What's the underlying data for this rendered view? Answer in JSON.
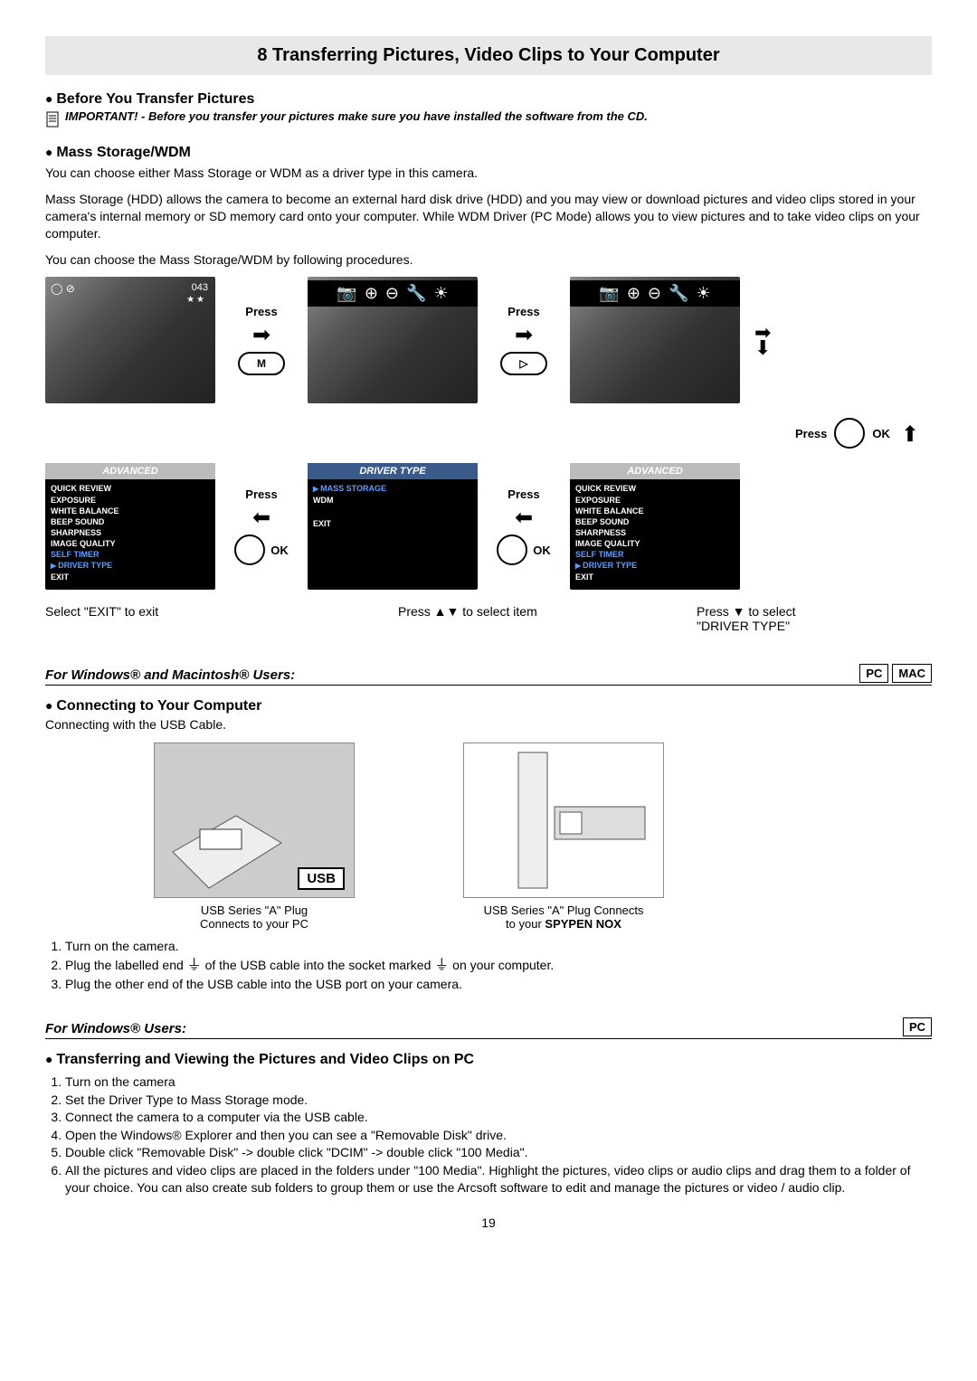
{
  "page": {
    "title": "8 Transferring Pictures, Video Clips to Your Computer",
    "number": "19"
  },
  "s1": {
    "heading": "Before You Transfer Pictures",
    "important": "IMPORTANT! - Before you transfer your pictures make sure you have installed the software from the CD."
  },
  "s2": {
    "heading": "Mass Storage/WDM",
    "p1": "You can choose either Mass Storage or WDM as a driver type in this camera.",
    "p2": "Mass Storage (HDD) allows the camera to become an external hard disk drive (HDD) and you may view or download pictures and video clips stored in your camera's internal memory or SD memory card onto your computer.  While WDM Driver (PC Mode) allows you to view pictures and to take video clips on your computer.",
    "p3": "You can choose the Mass Storage/WDM by following procedures."
  },
  "flow": {
    "press": "Press",
    "ok": "OK",
    "btn_m": "M",
    "btn_play": "▷",
    "screen1_counter": "043",
    "screen1_stars": "★★",
    "icons_camera": "📷",
    "icons_zoomin": "⊕",
    "icons_zoomout": "⊖",
    "icons_tool": "🔧",
    "icons_bright": "☀",
    "menu_adv_title": "ADVANCED",
    "menu_driver_title": "DRIVER TYPE",
    "menu_adv_items": [
      "QUICK REVIEW",
      "EXPOSURE",
      "WHITE BALANCE",
      "BEEP SOUND",
      "SHARPNESS",
      "IMAGE QUALITY",
      "SELF TIMER",
      "DRIVER TYPE",
      "EXIT"
    ],
    "menu_driver_items": [
      "MASS STORAGE",
      "WDM",
      "EXIT"
    ],
    "cap_exit": "Select \"EXIT\" to exit",
    "cap_select_item": "Press ▲▼ to select item",
    "cap_select_driver_a": "Press ▼ to select",
    "cap_select_driver_b": "\"DRIVER TYPE\""
  },
  "users_winmac": {
    "heading": "For Windows® and Macintosh® Users:",
    "badge_pc": "PC",
    "badge_mac": "MAC"
  },
  "s3": {
    "heading": "Connecting to Your Computer",
    "sub": "Connecting with the USB Cable.",
    "illus1_badge": "USB",
    "illus1_cap_a": "USB Series \"A\" Plug",
    "illus1_cap_b": "Connects to your PC",
    "illus2_cap_a": "USB Series \"A\" Plug Connects",
    "illus2_cap_b": "to your ",
    "illus2_cap_bold": "SPYPEN NOX",
    "step1": "Turn on the camera.",
    "step2a": "Plug the labelled end ",
    "step2b": " of the USB cable into the socket marked ",
    "step2c": " on your computer.",
    "step3": "Plug the other end of the USB cable into the USB port on your camera."
  },
  "users_win": {
    "heading": "For Windows® Users:",
    "badge_pc": "PC"
  },
  "s4": {
    "heading": "Transferring and Viewing the Pictures and Video Clips on PC",
    "step1": "Turn on the camera",
    "step2": "Set the Driver Type to Mass Storage mode.",
    "step3": "Connect the camera to a computer via the USB cable.",
    "step4": "Open the Windows® Explorer and then you can see a \"Removable Disk\" drive.",
    "step5": "Double click \"Removable Disk\" -> double click \"DCIM\" -> double click \"100 Media\".",
    "step6": "All the pictures and video clips are placed in the folders under \"100 Media\".  Highlight the pictures, video clips or audio clips and drag them to a folder of your choice.  You can also create sub folders to group them or use the Arcsoft software to edit and manage the pictures or video / audio clip."
  }
}
